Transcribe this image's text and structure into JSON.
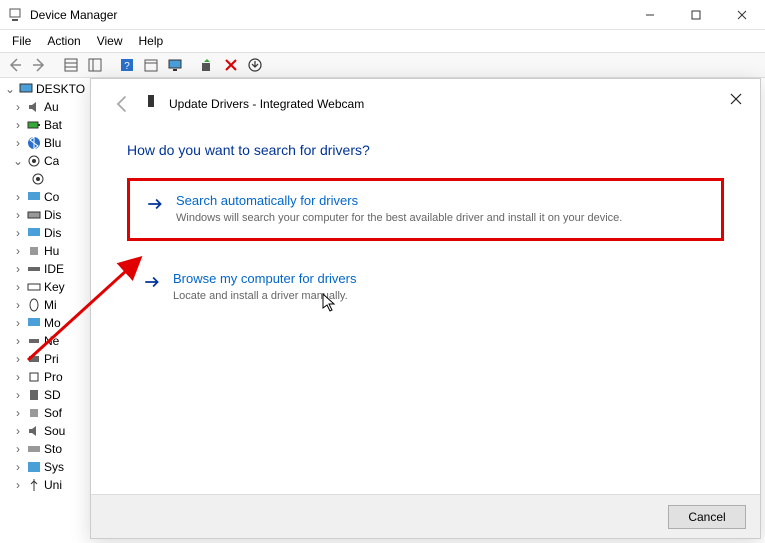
{
  "window": {
    "title": "Device Manager",
    "controls": {
      "minimize": "–",
      "maximize": "□",
      "close": "×"
    }
  },
  "menubar": [
    "File",
    "Action",
    "View",
    "Help"
  ],
  "tree": {
    "root": "DESKTO",
    "items": [
      {
        "label": "Au",
        "expanded": true
      },
      {
        "label": "Bat"
      },
      {
        "label": "Blu"
      },
      {
        "label": "Ca",
        "expanded": true,
        "children": [
          ""
        ]
      },
      {
        "label": "Co"
      },
      {
        "label": "Dis"
      },
      {
        "label": "Dis"
      },
      {
        "label": "Hu"
      },
      {
        "label": "IDE"
      },
      {
        "label": "Key"
      },
      {
        "label": "Mi"
      },
      {
        "label": "Mo"
      },
      {
        "label": "Ne"
      },
      {
        "label": "Pri"
      },
      {
        "label": "Pro"
      },
      {
        "label": "SD"
      },
      {
        "label": "Sof"
      },
      {
        "label": "Sou"
      },
      {
        "label": "Sto"
      },
      {
        "label": "Sys"
      },
      {
        "label": "Uni"
      }
    ]
  },
  "dialog": {
    "title": "Update Drivers - Integrated Webcam",
    "heading": "How do you want to search for drivers?",
    "options": [
      {
        "title": "Search automatically for drivers",
        "desc": "Windows will search your computer for the best available driver and install it on your device.",
        "highlighted": true
      },
      {
        "title": "Browse my computer for drivers",
        "desc": "Locate and install a driver manually.",
        "highlighted": false
      }
    ],
    "cancel": "Cancel"
  },
  "annotation": {
    "color": "#e00000"
  }
}
